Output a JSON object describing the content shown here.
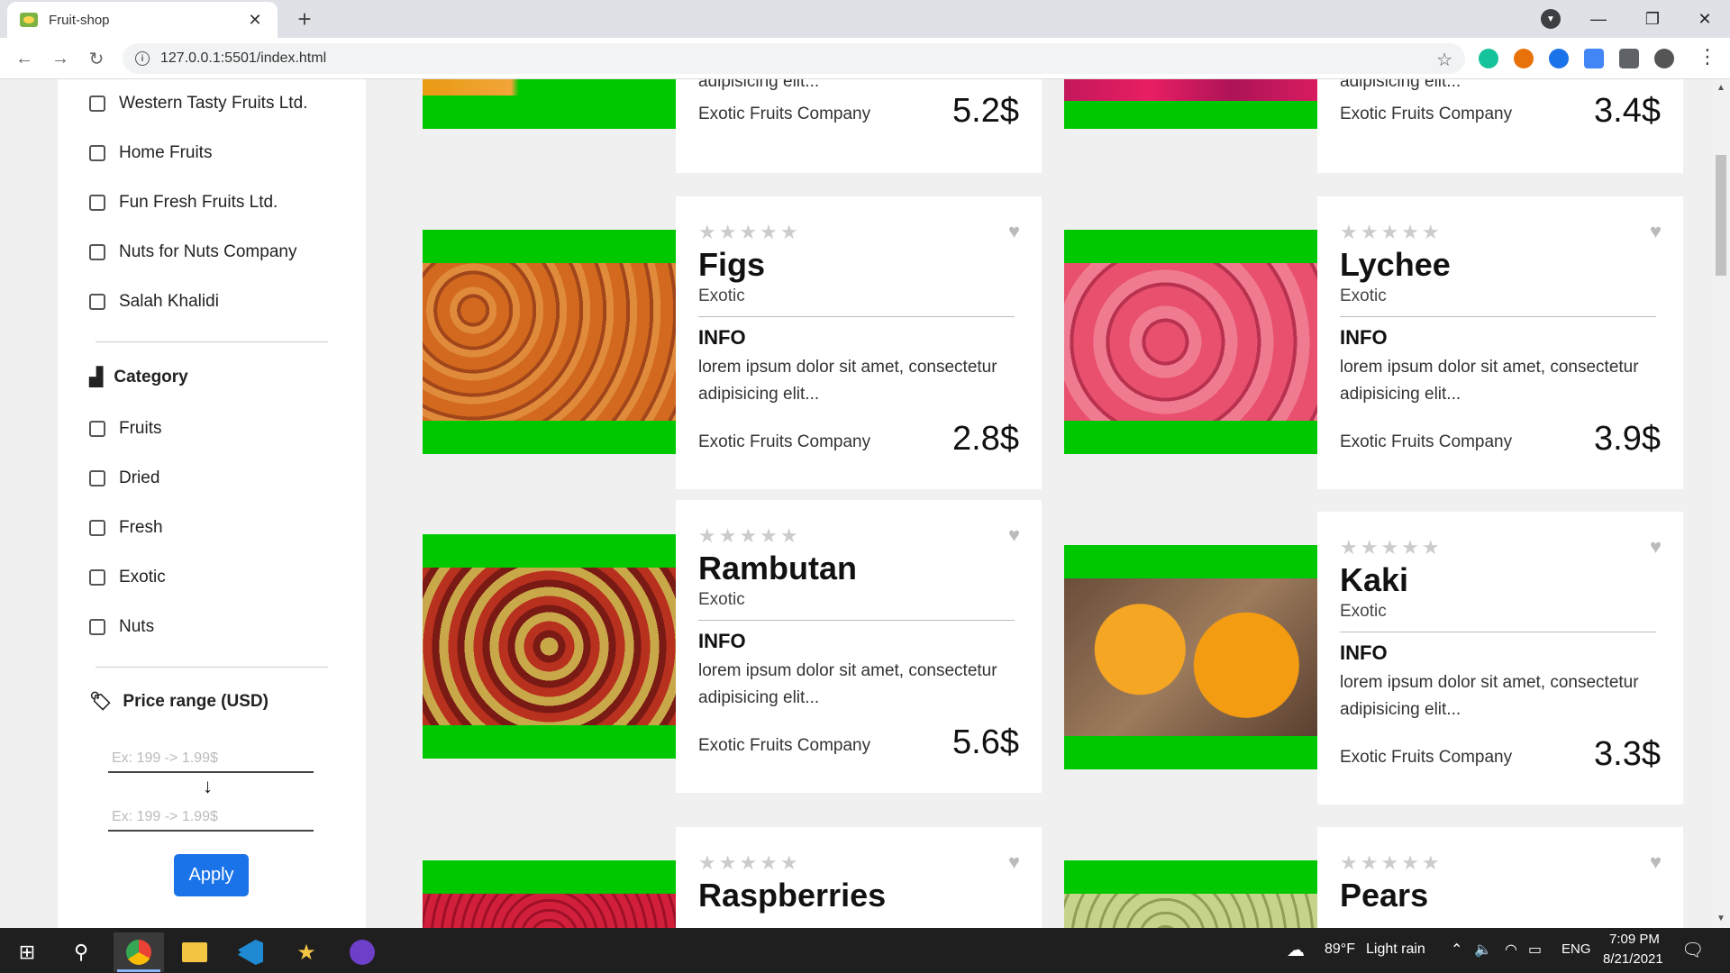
{
  "browser": {
    "tab_title": "Fruit-shop",
    "tab_close": "✕",
    "new_tab": "+",
    "url": "127.0.0.1:5501/index.html"
  },
  "sidebar": {
    "companies": [
      "Western Tasty Fruits Ltd.",
      "Home Fruits",
      "Fun Fresh Fruits Ltd.",
      "Nuts for Nuts Company",
      "Salah Khalidi"
    ],
    "category_title": "Category",
    "categories": [
      "Fruits",
      "Dried",
      "Fresh",
      "Exotic",
      "Nuts"
    ],
    "price_title": "Price range (USD)",
    "price_placeholder": "Ex: 199 -> 1.99$",
    "apply_label": "Apply"
  },
  "products": {
    "top_left": {
      "text": "adipisicing elit...",
      "company": "Exotic Fruits Company",
      "price": "5.2$"
    },
    "top_right": {
      "text": "adipisicing elit...",
      "company": "Exotic Fruits Company",
      "price": "3.4$"
    },
    "figs": {
      "name": "Figs",
      "category": "Exotic",
      "info": "INFO",
      "text": "lorem ipsum dolor sit amet, consectetur adipisicing elit...",
      "company": "Exotic Fruits Company",
      "price": "2.8$"
    },
    "lychee": {
      "name": "Lychee",
      "category": "Exotic",
      "info": "INFO",
      "text": "lorem ipsum dolor sit amet, consectetur adipisicing elit...",
      "company": "Exotic Fruits Company",
      "price": "3.9$"
    },
    "rambutan": {
      "name": "Rambutan",
      "category": "Exotic",
      "info": "INFO",
      "text": "lorem ipsum dolor sit amet, consectetur adipisicing elit...",
      "company": "Exotic Fruits Company",
      "price": "5.6$"
    },
    "kaki": {
      "name": "Kaki",
      "category": "Exotic",
      "info": "INFO",
      "text": "lorem ipsum dolor sit amet, consectetur adipisicing elit...",
      "company": "Exotic Fruits Company",
      "price": "3.3$"
    },
    "raspberries": {
      "name": "Raspberries"
    },
    "pears": {
      "name": "Pears"
    }
  },
  "rating_stars": "★★★★★",
  "heart": "♥",
  "taskbar": {
    "weather_temp": "89°F",
    "weather_desc": "Light rain",
    "language": "ENG",
    "time": "7:09 PM",
    "date": "8/21/2021"
  },
  "colors": {
    "accent_green": "#00c800",
    "apply_blue": "#1a73e8"
  }
}
